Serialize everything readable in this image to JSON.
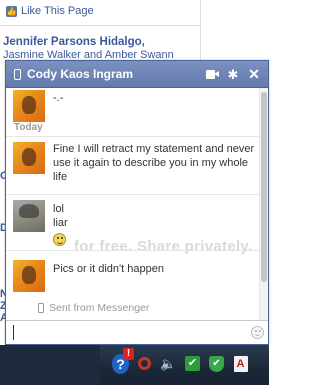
{
  "background": {
    "like_link": "Like This Page",
    "person_name": "Jennifer Parsons Hidalgo,",
    "person_sub": "Jasmine Walker and Amber Swann",
    "edge_letters": [
      "C",
      "D",
      "N",
      "Z",
      "A"
    ]
  },
  "chat": {
    "title": "Cody Kaos Ingram",
    "header_icons": [
      "video-call-icon",
      "settings-gear-icon",
      "close-icon"
    ],
    "messages": [
      {
        "from": "Cody Kaos Ingram",
        "text": "-.-"
      },
      {
        "from": "Cody Kaos Ingram",
        "text": "Fine I will retract my statement and never use it again to describe you in my whole life"
      },
      {
        "from": "me",
        "lines": [
          "lol",
          "liar"
        ],
        "emoticon": "smiley-icon"
      },
      {
        "from": "Cody Kaos Ingram",
        "text": "Pics or it didn't happen"
      }
    ],
    "date_separator": "Today",
    "sent_from": "Sent from Messenger",
    "watermark": "for free. Share privately.",
    "input": {
      "value": ""
    }
  },
  "taskbar": {
    "tray_icons": [
      "help-icon",
      "alert-icon",
      "red-ring-icon",
      "speaker-icon",
      "green-check-icon",
      "shield-icon",
      "pdf-icon"
    ]
  }
}
